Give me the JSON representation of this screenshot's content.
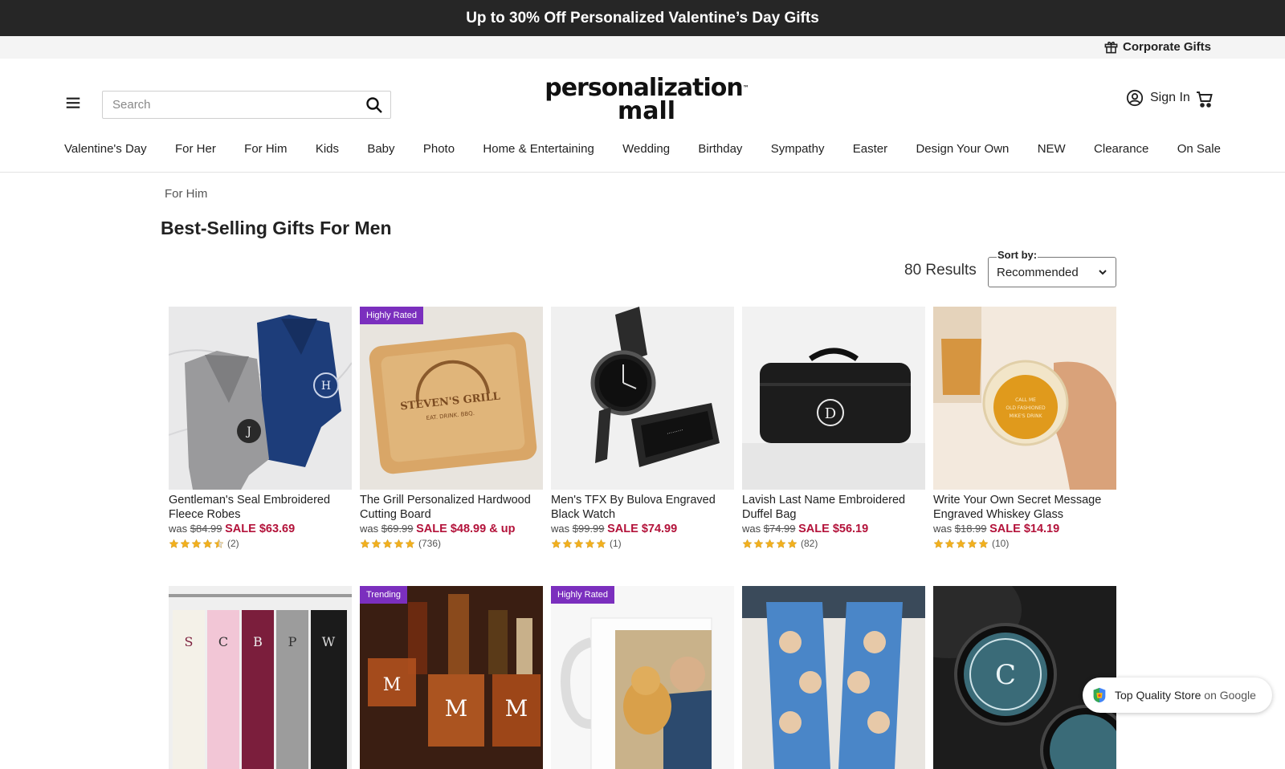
{
  "promo": {
    "text": "Up to 30% Off Personalized Valentine’s Day Gifts"
  },
  "utility": {
    "corporate": "Corporate Gifts"
  },
  "header": {
    "search_placeholder": "Search",
    "logo_line1": "personalization",
    "logo_line2": "mall",
    "logo_tm": "™",
    "signin": "Sign In"
  },
  "nav": [
    "Valentine's Day",
    "For Her",
    "For Him",
    "Kids",
    "Baby",
    "Photo",
    "Home & Entertaining",
    "Wedding",
    "Birthday",
    "Sympathy",
    "Easter",
    "Design Your Own",
    "NEW",
    "Clearance",
    "On Sale"
  ],
  "breadcrumb": "For Him",
  "page_title": "Best-Selling Gifts For Men",
  "results": "80 Results",
  "sort": {
    "label": "Sort by:",
    "value": "Recommended"
  },
  "products": [
    {
      "title": "Gentleman's Seal Embroidered Fleece Robes",
      "was_label": "was",
      "was": "$84.99",
      "sale": "SALE $63.69",
      "stars": 4.5,
      "count": "(2)",
      "badge": ""
    },
    {
      "title": "The Grill Personalized Hardwood Cutting Board",
      "was_label": "was",
      "was": "$69.99",
      "sale": "SALE $48.99 & up",
      "stars": 5,
      "count": "(736)",
      "badge": "Highly Rated"
    },
    {
      "title": "Men's TFX By Bulova Engraved Black Watch",
      "was_label": "was",
      "was": "$99.99",
      "sale": "SALE $74.99",
      "stars": 5,
      "count": "(1)",
      "badge": ""
    },
    {
      "title": "Lavish Last Name Embroidered Duffel Bag",
      "was_label": "was",
      "was": "$74.99",
      "sale": "SALE $56.19",
      "stars": 5,
      "count": "(82)",
      "badge": ""
    },
    {
      "title": "Write Your Own Secret Message Engraved Whiskey Glass",
      "was_label": "was",
      "was": "$18.99",
      "sale": "SALE $14.19",
      "stars": 5,
      "count": "(10)",
      "badge": ""
    },
    {
      "badge": ""
    },
    {
      "badge": "Trending"
    },
    {
      "badge": "Highly Rated"
    },
    {
      "badge": ""
    },
    {
      "badge": ""
    }
  ],
  "image_text": {
    "board_name": "STEVEN'S GRILL",
    "board_sub": "EAT. DRINK. BBQ.",
    "glass_lines": [
      "CALL ME",
      "OLD FASHIONED",
      "MIKE'S DRINK"
    ],
    "robe_initial_1": "J",
    "robe_initial_2": "H",
    "robes_letters": [
      "S",
      "C",
      "B",
      "P",
      "W"
    ],
    "bag_initial": "D",
    "whiskey_initial": "M",
    "mug_initial": "C"
  },
  "google_badge": {
    "text": "Top Quality Store",
    "suffix": "on Google"
  },
  "colors": {
    "promo_bg": "#262626",
    "sale": "#b3123a",
    "badge": "#7b2fbe",
    "star": "#f2b01e"
  }
}
